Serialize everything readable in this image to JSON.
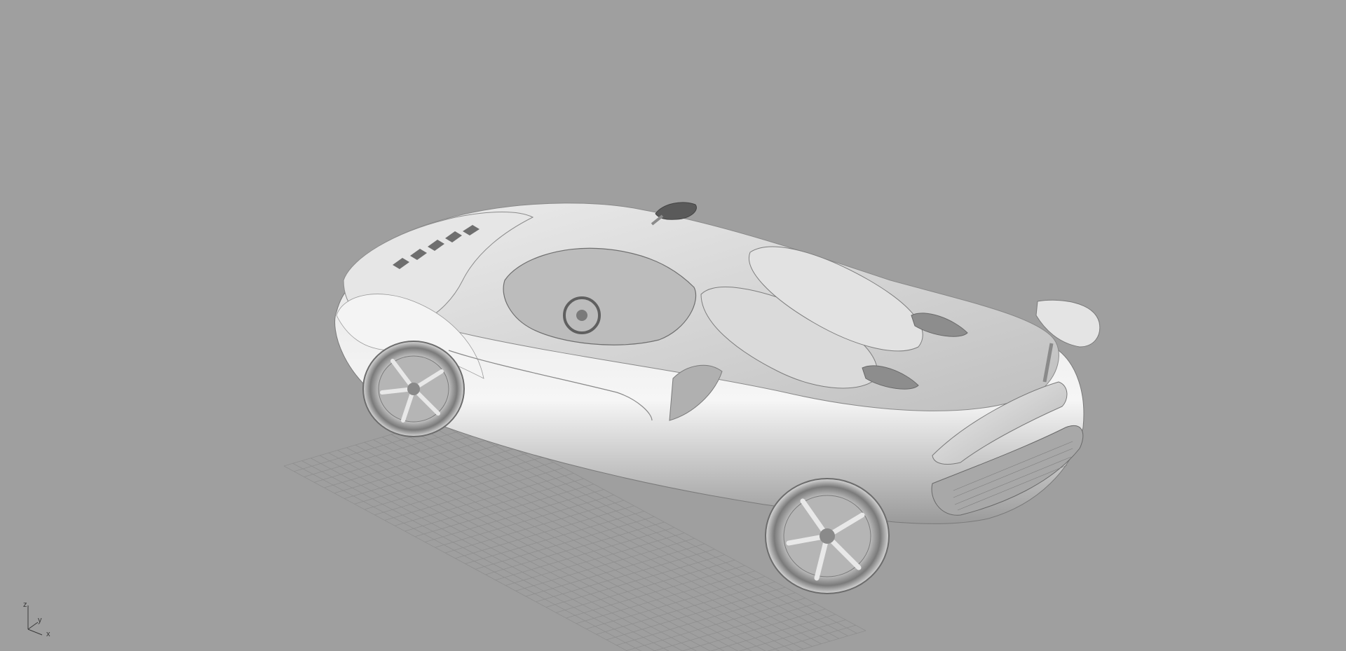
{
  "viewport": {
    "background": "#9f9f9f",
    "display_mode": "shaded",
    "grid_color": "#8f8f8f",
    "model_color": "#d9d9d9"
  },
  "axis_widget": {
    "z_label": "z",
    "y_label": "y",
    "x_label": "x"
  }
}
